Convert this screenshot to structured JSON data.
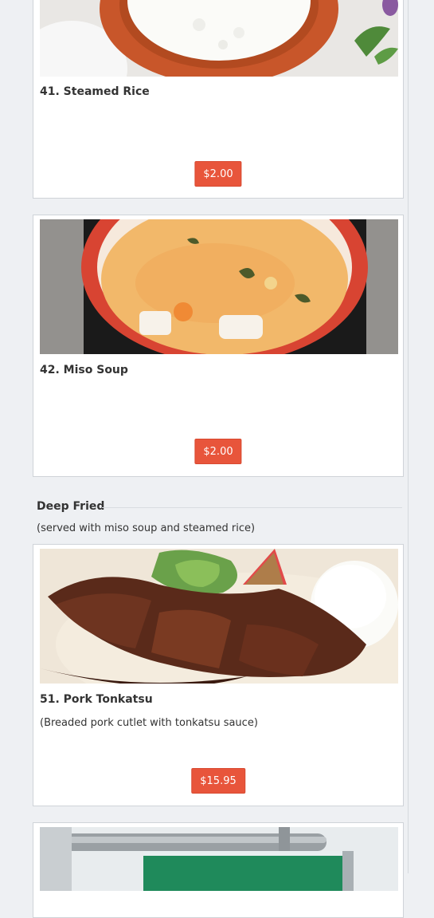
{
  "menu": {
    "items": [
      {
        "id": "steamed-rice",
        "name": "41. Steamed Rice",
        "description": "",
        "price": "$2.00",
        "photo": "steamed rice in red bowl"
      },
      {
        "id": "miso-soup",
        "name": "42. Miso Soup",
        "description": "",
        "price": "$2.00",
        "photo": "miso soup in red bowl"
      },
      {
        "id": "pork-tonkatsu",
        "name": "51. Pork Tonkatsu",
        "description": "(Breaded pork cutlet with tonkatsu sauce)",
        "price": "$15.95",
        "photo": "pork tonkatsu with rice and salad"
      }
    ],
    "section": {
      "title": "Deep Fried",
      "subtitle": "(served with miso soup and steamed rice)"
    }
  },
  "colors": {
    "price_button": "#e8553b",
    "page_bg": "#eef0f3",
    "card_border": "#cfd3d8"
  }
}
